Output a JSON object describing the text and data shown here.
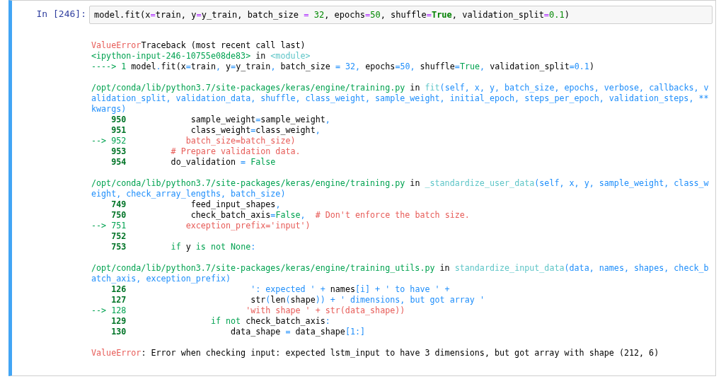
{
  "cell": {
    "prompt": "In [246]:",
    "input": [
      {
        "t": "model.fit(x",
        "kind": "plain"
      },
      {
        "t": "=",
        "kind": "op"
      },
      {
        "t": "train, y",
        "kind": "plain"
      },
      {
        "t": "=",
        "kind": "op"
      },
      {
        "t": "y_train, batch_size ",
        "kind": "plain"
      },
      {
        "t": "= ",
        "kind": "op"
      },
      {
        "t": "32",
        "kind": "num"
      },
      {
        "t": ", epochs",
        "kind": "plain"
      },
      {
        "t": "=",
        "kind": "op"
      },
      {
        "t": "50",
        "kind": "num"
      },
      {
        "t": ", shuffle",
        "kind": "plain"
      },
      {
        "t": "=",
        "kind": "op"
      },
      {
        "t": "True",
        "kind": "kw"
      },
      {
        "t": ", validation_split",
        "kind": "plain"
      },
      {
        "t": "=",
        "kind": "op"
      },
      {
        "t": "0.1",
        "kind": "num"
      },
      {
        "t": ")",
        "kind": "plain"
      }
    ],
    "output": [
      [
        [
          {
            "t": "ValueError",
            "kind": "red"
          },
          {
            "t": "Traceback (most recent call last)",
            "kind": "plain"
          }
        ],
        [
          {
            "t": "<ipython-input-246-10755e08de83>",
            "kind": "green"
          },
          {
            "t": " in ",
            "kind": "plain"
          },
          {
            "t": "<module>",
            "kind": "cyan"
          }
        ],
        [
          {
            "t": "----> 1",
            "kind": "green"
          },
          {
            "t": " model",
            "kind": "plain"
          },
          {
            "t": ".",
            "kind": "blue"
          },
          {
            "t": "fit(x",
            "kind": "plain"
          },
          {
            "t": "=",
            "kind": "blue"
          },
          {
            "t": "train",
            "kind": "plain"
          },
          {
            "t": ",",
            "kind": "blue"
          },
          {
            "t": " y",
            "kind": "plain"
          },
          {
            "t": "=",
            "kind": "blue"
          },
          {
            "t": "y_train",
            "kind": "plain"
          },
          {
            "t": ",",
            "kind": "blue"
          },
          {
            "t": " batch_size ",
            "kind": "plain"
          },
          {
            "t": "=",
            "kind": "blue"
          },
          {
            "t": " 32,",
            "kind": "blue"
          },
          {
            "t": " epochs",
            "kind": "plain"
          },
          {
            "t": "=",
            "kind": "blue"
          },
          {
            "t": "50",
            "kind": "blue"
          },
          {
            "t": ",",
            "kind": "blue"
          },
          {
            "t": " shuffle",
            "kind": "plain"
          },
          {
            "t": "=",
            "kind": "blue"
          },
          {
            "t": "True",
            "kind": "green"
          },
          {
            "t": ",",
            "kind": "blue"
          },
          {
            "t": " validation_split",
            "kind": "plain"
          },
          {
            "t": "=",
            "kind": "blue"
          },
          {
            "t": "0.1",
            "kind": "blue"
          },
          {
            "t": ")",
            "kind": "plain"
          }
        ]
      ],
      [
        [
          {
            "t": "/opt/conda/lib/python3.7/site-packages/keras/engine/training.py",
            "kind": "green"
          },
          {
            "t": " in ",
            "kind": "plain"
          },
          {
            "t": "fit",
            "kind": "cyan"
          },
          {
            "t": "(self, x, y, batch_size, epochs, verbose, callbacks, v",
            "kind": "blue"
          }
        ],
        [
          {
            "t": "alidation_split, validation_data, shuffle, class_weight, sample_weight, initial_epoch, steps_per_epoch, validation_steps, **",
            "kind": "blue"
          }
        ],
        [
          {
            "t": "kwargs)",
            "kind": "blue"
          }
        ],
        [
          {
            "t": "    950",
            "kind": "lineno"
          },
          {
            "t": "             sample_weight",
            "kind": "plain"
          },
          {
            "t": "=",
            "kind": "blue"
          },
          {
            "t": "sample_weight",
            "kind": "plain"
          },
          {
            "t": ",",
            "kind": "blue"
          }
        ],
        [
          {
            "t": "    951",
            "kind": "lineno"
          },
          {
            "t": "             class_weight",
            "kind": "plain"
          },
          {
            "t": "=",
            "kind": "blue"
          },
          {
            "t": "class_weight",
            "kind": "plain"
          },
          {
            "t": ",",
            "kind": "blue"
          }
        ],
        [
          {
            "t": "--> 952",
            "kind": "green"
          },
          {
            "t": "            batch_size=batch_size)",
            "kind": "red"
          }
        ],
        [
          {
            "t": "    953",
            "kind": "lineno"
          },
          {
            "t": "         # Prepare validation data.",
            "kind": "red"
          }
        ],
        [
          {
            "t": "    954",
            "kind": "lineno"
          },
          {
            "t": "         do_validation ",
            "kind": "plain"
          },
          {
            "t": "=",
            "kind": "blue"
          },
          {
            "t": " False",
            "kind": "green"
          }
        ]
      ],
      [
        [
          {
            "t": "/opt/conda/lib/python3.7/site-packages/keras/engine/training.py",
            "kind": "green"
          },
          {
            "t": " in ",
            "kind": "plain"
          },
          {
            "t": "_standardize_user_data",
            "kind": "cyan"
          },
          {
            "t": "(self, x, y, sample_weight, class_w",
            "kind": "blue"
          }
        ],
        [
          {
            "t": "eight, check_array_lengths, batch_size)",
            "kind": "blue"
          }
        ],
        [
          {
            "t": "    749",
            "kind": "lineno"
          },
          {
            "t": "             feed_input_shapes",
            "kind": "plain"
          },
          {
            "t": ",",
            "kind": "blue"
          }
        ],
        [
          {
            "t": "    750",
            "kind": "lineno"
          },
          {
            "t": "             check_batch_axis",
            "kind": "plain"
          },
          {
            "t": "=",
            "kind": "blue"
          },
          {
            "t": "False",
            "kind": "green"
          },
          {
            "t": ",",
            "kind": "blue"
          },
          {
            "t": "  # Don't enforce the batch size.",
            "kind": "red"
          }
        ],
        [
          {
            "t": "--> 751",
            "kind": "green"
          },
          {
            "t": "            exception_prefix='input')",
            "kind": "red"
          }
        ],
        [
          {
            "t": "    752",
            "kind": "lineno"
          }
        ],
        [
          {
            "t": "    753         ",
            "kind": "lineno"
          },
          {
            "t": "if",
            "kind": "green"
          },
          {
            "t": " y ",
            "kind": "plain"
          },
          {
            "t": "is not None",
            "kind": "green"
          },
          {
            "t": ":",
            "kind": "blue"
          }
        ]
      ],
      [
        [
          {
            "t": "/opt/conda/lib/python3.7/site-packages/keras/engine/training_utils.py",
            "kind": "green"
          },
          {
            "t": " in ",
            "kind": "plain"
          },
          {
            "t": "standardize_input_data",
            "kind": "cyan"
          },
          {
            "t": "(data, names, shapes, check_b",
            "kind": "blue"
          }
        ],
        [
          {
            "t": "atch_axis, exception_prefix)",
            "kind": "blue"
          }
        ],
        [
          {
            "t": "    126                         ",
            "kind": "lineno"
          },
          {
            "t": "': expected ' + ",
            "kind": "blue"
          },
          {
            "t": "names",
            "kind": "plain"
          },
          {
            "t": "[i] + ' to have ' +",
            "kind": "blue"
          }
        ],
        [
          {
            "t": "    127",
            "kind": "lineno"
          },
          {
            "t": "                         str",
            "kind": "plain"
          },
          {
            "t": "(",
            "kind": "blue"
          },
          {
            "t": "len",
            "kind": "plain"
          },
          {
            "t": "(",
            "kind": "blue"
          },
          {
            "t": "shape",
            "kind": "plain"
          },
          {
            "t": ")) + ' dimensions, but got array '",
            "kind": "blue"
          }
        ],
        [
          {
            "t": "--> 128",
            "kind": "green"
          },
          {
            "t": "                        'with shape ' + str(data_shape))",
            "kind": "red"
          }
        ],
        [
          {
            "t": "    129                 ",
            "kind": "lineno"
          },
          {
            "t": "if not",
            "kind": "green"
          },
          {
            "t": " check_batch_axis",
            "kind": "plain"
          },
          {
            "t": ":",
            "kind": "blue"
          }
        ],
        [
          {
            "t": "    130",
            "kind": "lineno"
          },
          {
            "t": "                     data_shape ",
            "kind": "plain"
          },
          {
            "t": "=",
            "kind": "blue"
          },
          {
            "t": " data_shape",
            "kind": "plain"
          },
          {
            "t": "[1:]",
            "kind": "blue"
          }
        ]
      ],
      [
        [
          {
            "t": "ValueError",
            "kind": "red"
          },
          {
            "t": ": Error when checking input: expected lstm_input to have 3 dimensions, but got array with shape (212, 6)",
            "kind": "plain"
          }
        ]
      ]
    ]
  }
}
